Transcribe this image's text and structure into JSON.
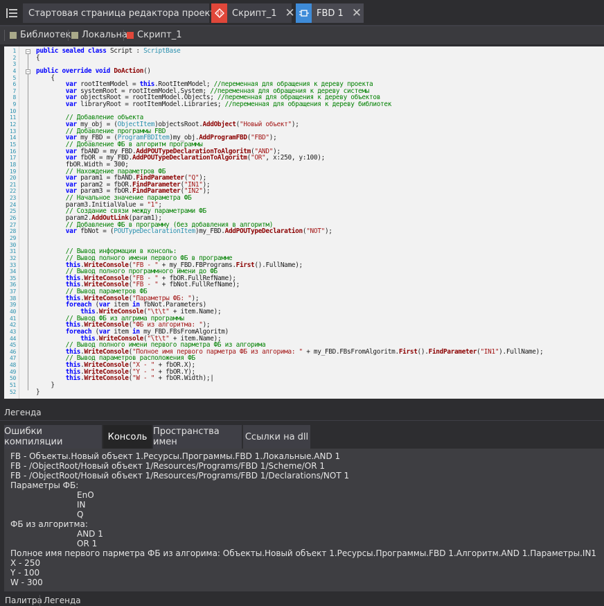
{
  "doc_tabs": [
    {
      "label": "Стартовая страница редактора проектов",
      "icon": "none",
      "close": "✕"
    },
    {
      "label": "Скрипт_1",
      "icon": "script-icon",
      "close": "✕"
    },
    {
      "label": "FBD 1",
      "icon": "fbd-icon",
      "close": "✕"
    }
  ],
  "breadcrumbs": [
    {
      "label": "Библиотеки",
      "color": "#a9a98a"
    },
    {
      "label": "Локальная",
      "color": "#a9a98a"
    },
    {
      "label": "Скрипт_1",
      "color": "#e0473a"
    }
  ],
  "code_lines": [
    "public sealed class Script : ScriptBase",
    "{",
    "",
    "public override void DoAction()",
    "    {",
    "        var rootItemModel = this.RootItemModel; //переменная для обращения к дереву проекта",
    "        var systemRoot = rootItemModel.System; //переменная для обращения к дереву системы",
    "        var objectsRoot = rootItemModel.Objects; //переменная для обращения к дереву объектов",
    "        var libraryRoot = rootItemModel.Libraries; //переменная для обращения к дереву библиотек",
    "",
    "        // Добавление объекта",
    "        var my_obj = (ObjectItem)objectsRoot.AddObject(\"Новый объект\");",
    "        // Добавление программы FBD",
    "        var my_FBD = (ProgramFBDItem)my_obj.AddProgramFBD(\"FBD\");",
    "        // Добавление ФБ в алгоритм программы",
    "        var fbAND = my_FBD.AddPOUTypeDeclarationToAlgoritm(\"AND\");",
    "        var fbOR = my_FBD.AddPOUTypeDeclarationToAlgoritm(\"OR\", x:250, y:100);",
    "        fbOR.Width = 300;",
    "        // Нахождение параметров ФБ",
    "        var param1 = fbAND.FindParameter(\"Q\");",
    "        var param2 = fbOR.FindParameter(\"IN1\");",
    "        var param3 = fbOR.FindParameter(\"IN2\");",
    "        // Начальное значение параметра ФБ",
    "        param3.InitialValue = \"1\";",
    "        // Создание связи между параметрами ФБ",
    "        param2.AddOutLink(param1);",
    "        // Добавление ФБ в программу (без добавления в алгоритм)",
    "        var fbNot = (POUTypeDeclarationItem)my_FBD.AddPOUTypeDeclaration(\"NOT\");",
    "",
    "",
    "        // Вывод информации в консоль:",
    "        // Вывод полного имени первого ФБ в программе",
    "        this.WriteConsole(\"FB - \" + my_FBD.FBPrograms.First().FullName);",
    "        // Вывод полного программного имени до ФБ",
    "        this.WriteConsole(\"FB - \" + fbOR.FullRefName);",
    "        this.WriteConsole(\"FB - \" + fbNot.FullRefName);",
    "        // Вывод параметров ФБ",
    "        this.WriteConsole(\"Параметры ФБ: \");",
    "        foreach (var item in fbNot.Parameters)",
    "            this.WriteConsole(\"\\t\\t\" + item.Name);",
    "        // Вывод ФБ из алгрима программы",
    "        this.WriteConsole(\"ФБ из алгоритма: \");",
    "        foreach (var item in my_FBD.FBsFromAlgoritm)",
    "            this.WriteConsole(\"\\t\\t\" + item.Name);",
    "        // Вывод полного имени первого парметра ФБ из алгорима",
    "        this.WriteConsole(\"Полное имя первого парметра ФБ из алгорима: \" + my_FBD.FBsFromAlgoritm.First().FindParameter(\"IN1\").FullName);",
    "        // Вывод параметров расположения ФБ",
    "        this.WriteConsole(\"X - \" + fbOR.X);",
    "        this.WriteConsole(\"Y - \" + fbOR.Y);",
    "        this.WriteConsole(\"W - \" + fbOR.Width);|",
    "    }",
    "}"
  ],
  "legend_title": "Легенда",
  "output_tabs": [
    {
      "label": "Ошибки компиляции",
      "active": false
    },
    {
      "label": "Консоль",
      "active": true
    },
    {
      "label": "Пространства имен",
      "active": false
    },
    {
      "label": "Ссылки на dll",
      "active": false
    }
  ],
  "console_lines": [
    {
      "text": "FB - Объекты.Новый объект 1.Ресурсы.Программы.FBD 1.Локальные.AND 1",
      "indent": 0
    },
    {
      "text": "FB - /ObjectRoot/Новый объект 1/Resources/Programs/FBD 1/Scheme/OR 1",
      "indent": 0
    },
    {
      "text": "FB - /ObjectRoot/Новый объект 1/Resources/Programs/FBD 1/Declarations/NOT 1",
      "indent": 0
    },
    {
      "text": "Параметры ФБ:",
      "indent": 0
    },
    {
      "text": "EnO",
      "indent": 1
    },
    {
      "text": "IN",
      "indent": 1
    },
    {
      "text": "Q",
      "indent": 1
    },
    {
      "text": "ФБ из алгоритма:",
      "indent": 0
    },
    {
      "text": "AND 1",
      "indent": 1
    },
    {
      "text": "OR 1",
      "indent": 1
    },
    {
      "text": "Полное имя первого парметра ФБ из алгорима: Объекты.Новый объект 1.Ресурсы.Программы.FBD 1.Алгоритм.AND 1.Параметры.IN1",
      "indent": 0
    },
    {
      "text": "X - 250",
      "indent": 0
    },
    {
      "text": "Y - 100",
      "indent": 0
    },
    {
      "text": "W - 300",
      "indent": 0
    }
  ],
  "bottom_tabs": [
    "Палитра",
    "Легенда"
  ],
  "colors": {
    "accent_red": "#e0473a",
    "accent_blue": "#3e8bd8",
    "editor_bg": "#f2f2f2",
    "panel_bg": "#2d2d30",
    "console_bg": "#3e3e42"
  }
}
